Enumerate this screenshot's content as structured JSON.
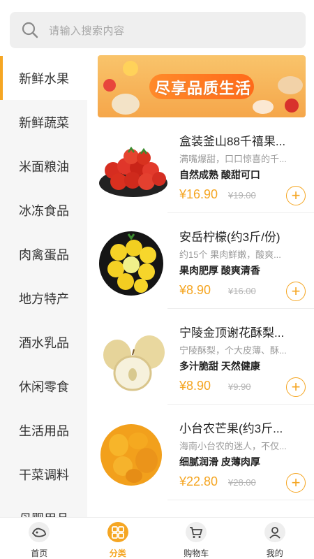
{
  "search": {
    "placeholder": "请输入搜索内容"
  },
  "sidebar": {
    "items": [
      {
        "label": "新鲜水果",
        "active": true
      },
      {
        "label": "新鲜蔬菜"
      },
      {
        "label": "米面粮油"
      },
      {
        "label": "冰冻食品"
      },
      {
        "label": "肉禽蛋品"
      },
      {
        "label": "地方特产"
      },
      {
        "label": "酒水乳品"
      },
      {
        "label": "休闲零食"
      },
      {
        "label": "生活用品"
      },
      {
        "label": "干菜调料"
      },
      {
        "label": "母婴用品"
      }
    ]
  },
  "banner": {
    "title": "尽享品质生活"
  },
  "products": [
    {
      "name": "盒装釜山88千禧果...",
      "desc": "满嘴爆甜，口口惊喜的千...",
      "tags": "自然成熟  酸甜可口",
      "price": "¥16.90",
      "old_price": "¥19.00",
      "image": "cherry-tomato"
    },
    {
      "name": "安岳柠檬(约3斤/份)",
      "desc": "约15个 果肉鲜嫩，酸爽...",
      "tags": "果肉肥厚  酸爽清香",
      "price": "¥8.90",
      "old_price": "¥16.00",
      "image": "lemon"
    },
    {
      "name": "宁陵金顶谢花酥梨...",
      "desc": "宁陵酥梨，个大皮薄、酥...",
      "tags": "多汁脆甜  天然健康",
      "price": "¥8.90",
      "old_price": "¥9.90",
      "image": "pear"
    },
    {
      "name": "小台农芒果(约3斤...",
      "desc": "海南小台农的迷人，不仅...",
      "tags": "细腻润滑  皮薄肉厚",
      "price": "¥22.80",
      "old_price": "¥28.00",
      "image": "mango"
    }
  ],
  "add_symbol": "+",
  "tabbar": {
    "items": [
      {
        "label": "首页",
        "icon": "home-icon"
      },
      {
        "label": "分类",
        "icon": "category-icon",
        "active": true
      },
      {
        "label": "购物车",
        "icon": "cart-icon"
      },
      {
        "label": "我的",
        "icon": "user-icon"
      }
    ]
  },
  "colors": {
    "accent": "#f5a623",
    "sidebar_bg": "#f6f6f6",
    "search_bg": "#efefef"
  }
}
